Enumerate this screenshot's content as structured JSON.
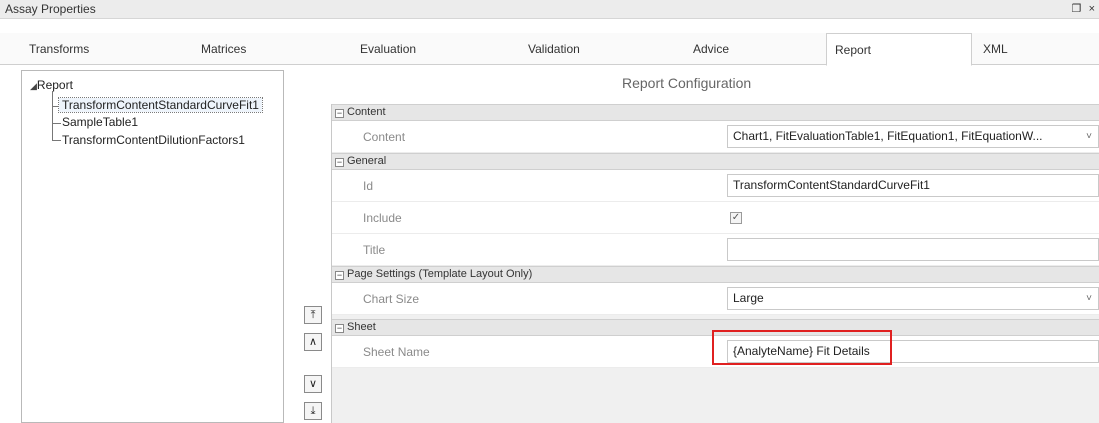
{
  "window": {
    "title": "Assay Properties",
    "controls": "❐ ×"
  },
  "tabs": [
    {
      "label": "Transforms",
      "active": false
    },
    {
      "label": "Matrices",
      "active": false
    },
    {
      "label": "Evaluation",
      "active": false
    },
    {
      "label": "Validation",
      "active": false
    },
    {
      "label": "Advice",
      "active": false
    },
    {
      "label": "Report",
      "active": true
    },
    {
      "label": "XML",
      "active": false
    }
  ],
  "tree": {
    "root_expander": "◢",
    "root_label": "Report",
    "items": [
      {
        "label": "TransformContentStandardCurveFit1",
        "selected": true
      },
      {
        "label": "SampleTable1",
        "selected": false
      },
      {
        "label": "TransformContentDilutionFactors1",
        "selected": false
      }
    ]
  },
  "move_buttons": {
    "top": "⤒",
    "up": "∧",
    "down": "∨",
    "bottom": "⤓"
  },
  "config": {
    "title": "Report Configuration",
    "categories": {
      "content": {
        "toggle": "−",
        "label": "Content",
        "props": {
          "content_label": "Content",
          "content_value": "Chart1, FitEvaluationTable1, FitEquation1, FitEquationW...",
          "content_arrow": "˅"
        }
      },
      "general": {
        "toggle": "−",
        "label": "General",
        "props": {
          "id_label": "Id",
          "id_value": "TransformContentStandardCurveFit1",
          "include_label": "Include",
          "include_checked": "✓",
          "title_label": "Title",
          "title_value": ""
        }
      },
      "page_settings": {
        "toggle": "−",
        "label": "Page Settings (Template Layout Only)",
        "props": {
          "chart_size_label": "Chart Size",
          "chart_size_value": "Large",
          "chart_size_arrow": "˅"
        }
      },
      "sheet": {
        "toggle": "−",
        "label": "Sheet",
        "props": {
          "sheet_name_label": "Sheet Name",
          "sheet_name_value": "{AnalyteName} Fit Details"
        }
      }
    }
  },
  "colors": {
    "highlight": "#e02020",
    "category_bg": "#e6e6e6"
  }
}
